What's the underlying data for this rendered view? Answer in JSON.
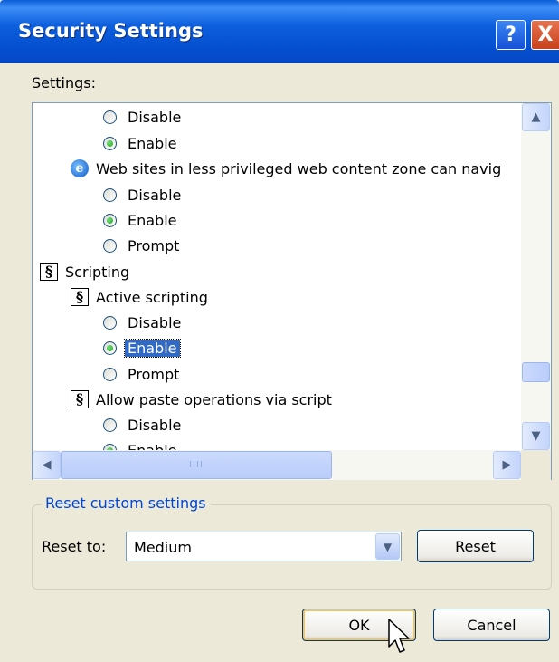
{
  "window": {
    "title": "Security Settings",
    "help_icon": "?",
    "close_icon": "X"
  },
  "settings_label": "Settings:",
  "settings_list": {
    "rows": [
      {
        "type": "radio",
        "label": "Disable",
        "checked": false
      },
      {
        "type": "radio",
        "label": "Enable",
        "checked": true
      },
      {
        "type": "ie-setting",
        "label": "Web sites in less privileged web content zone can navig"
      },
      {
        "type": "radio",
        "label": "Disable",
        "checked": false
      },
      {
        "type": "radio",
        "label": "Enable",
        "checked": true
      },
      {
        "type": "radio",
        "label": "Prompt",
        "checked": false
      },
      {
        "type": "category",
        "label": "Scripting"
      },
      {
        "type": "setting",
        "label": "Active scripting"
      },
      {
        "type": "radio",
        "label": "Disable",
        "checked": false
      },
      {
        "type": "radio",
        "label": "Enable",
        "checked": true,
        "selected": true
      },
      {
        "type": "radio",
        "label": "Prompt",
        "checked": false
      },
      {
        "type": "setting",
        "label": "Allow paste operations via script"
      },
      {
        "type": "radio",
        "label": "Disable",
        "checked": false
      },
      {
        "type": "radio",
        "label": "Enable",
        "checked": true
      }
    ]
  },
  "scrollbar": {
    "horizontal_grip": "IIII"
  },
  "reset_group": {
    "title": "Reset custom settings",
    "reset_to_label": "Reset to:",
    "level_value": "Medium",
    "reset_button": "Reset"
  },
  "buttons": {
    "ok": "OK",
    "cancel": "Cancel"
  },
  "colors": {
    "titlebar": "#0a5cd8",
    "selection": "#316ac5",
    "group_title": "#0046d5"
  }
}
